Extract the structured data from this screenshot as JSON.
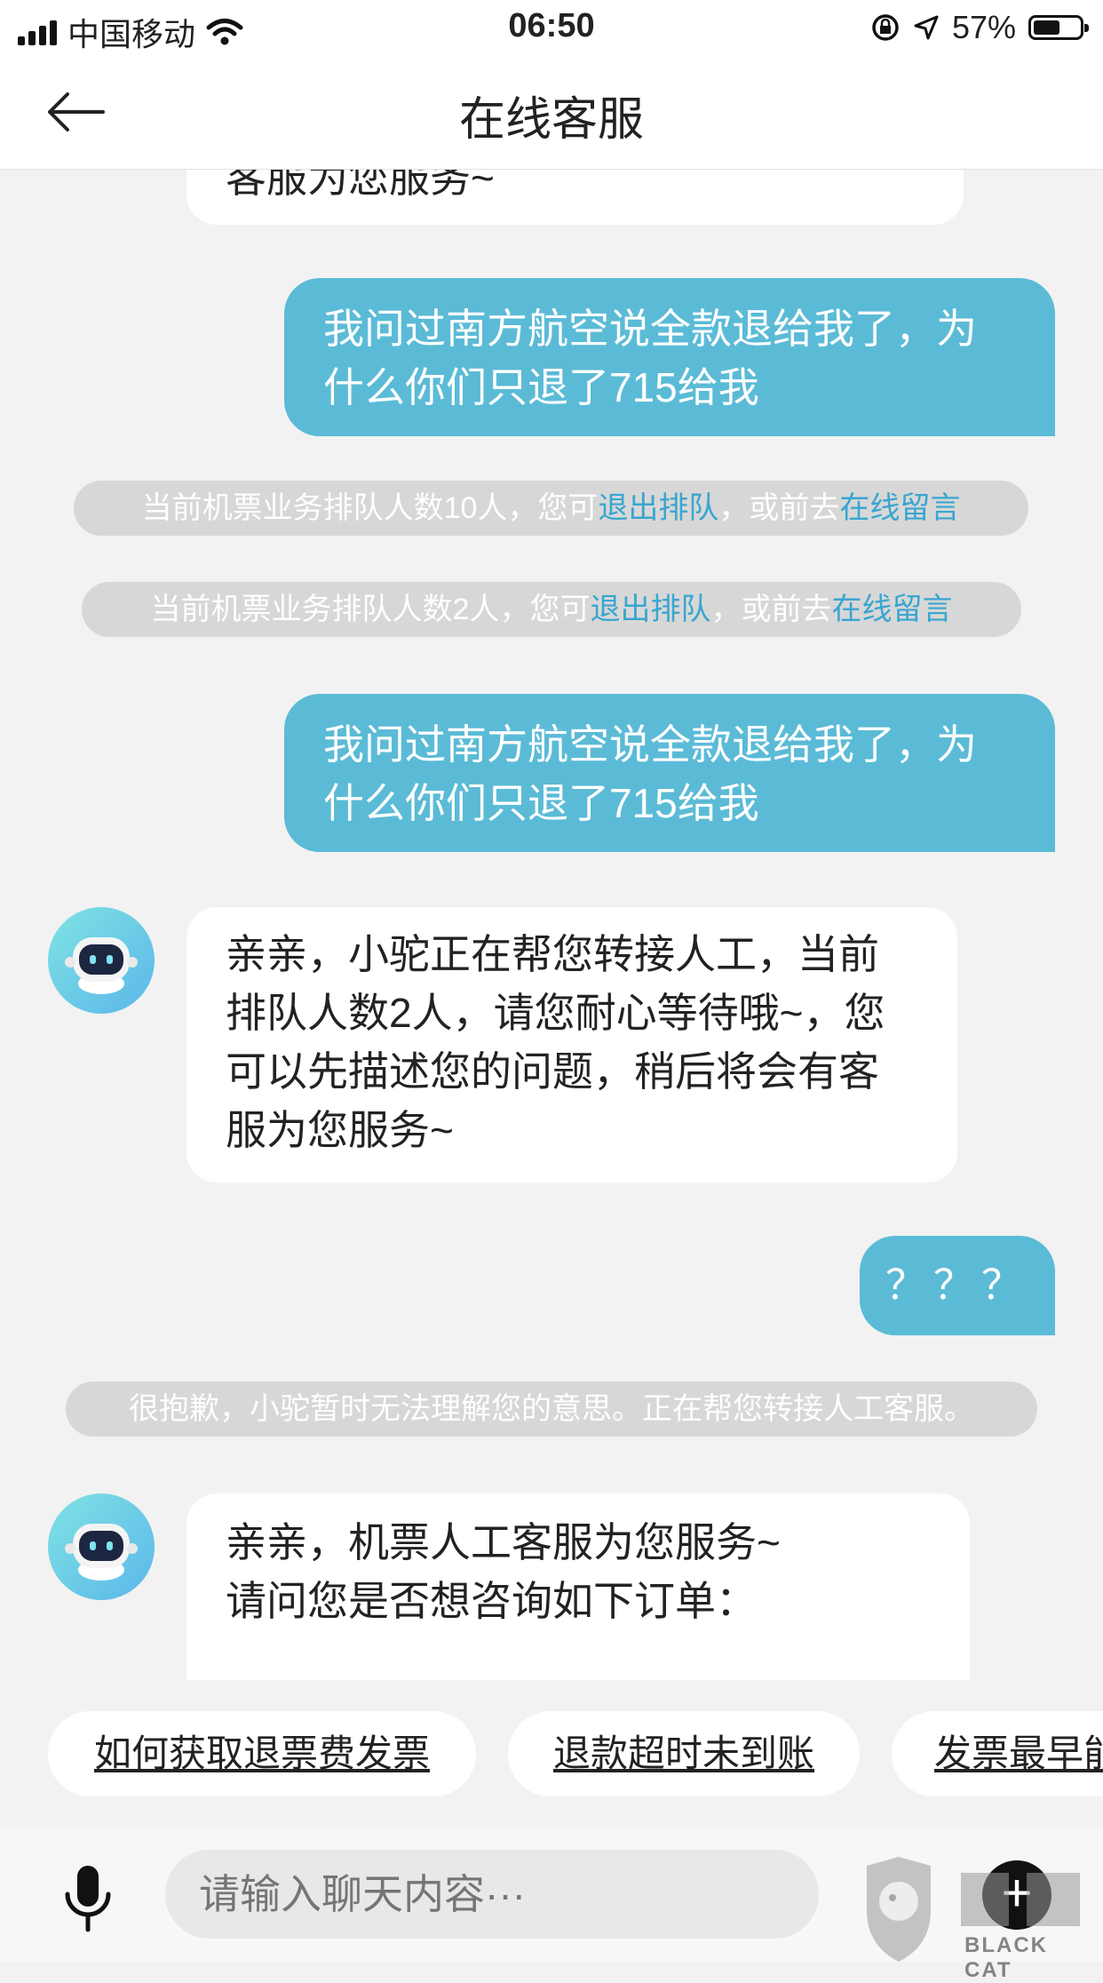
{
  "status_bar": {
    "carrier": "中国移动",
    "time": "06:50",
    "battery": "57%",
    "battery_level": 0.57
  },
  "nav": {
    "title": "在线客服"
  },
  "messages": {
    "top_partial": "客服为您服务~",
    "user_1": "我问过南方航空说全款退给我了，为什么你们只退了715给我",
    "sys_1": {
      "pre": "当前机票业务排队人数10人，您可",
      "link1": "退出排队",
      "mid": "，或前去",
      "link2": "在线留言"
    },
    "sys_2": {
      "pre": "当前机票业务排队人数2人，您可",
      "link1": "退出排队",
      "mid": "，或前去",
      "link2": "在线留言"
    },
    "user_2": "我问过南方航空说全款退给我了，为什么你们只退了715给我",
    "bot_1": "亲亲，小驼正在帮您转接人工，当前排队人数2人，请您耐心等待哦~，您可以先描述您的问题，稍后将会有客服为您服务~",
    "user_3": "？？？",
    "sys_3": "很抱歉，小驼暂时无法理解您的意思。正在帮您转接人工客服。",
    "bot_2_line1": "亲亲，机票人工客服为您服务~",
    "bot_2_line2": "请问您是否想咨询如下订单："
  },
  "quick_replies": [
    "如何获取退票费发票",
    "退款超时未到账",
    "发票最早能"
  ],
  "input": {
    "placeholder": "请输入聊天内容···"
  },
  "watermark": {
    "text": "BLACK CAT"
  },
  "colors": {
    "user_bubble": "#5bbbd6",
    "link": "#38a6d0",
    "system_pill": "#d7d7d7"
  },
  "icons": [
    "back-arrow-icon",
    "wifi-icon",
    "signal-icon",
    "lock-rotation-icon",
    "location-arrow-icon",
    "battery-icon",
    "robot-avatar-icon",
    "microphone-icon",
    "plus-icon"
  ]
}
